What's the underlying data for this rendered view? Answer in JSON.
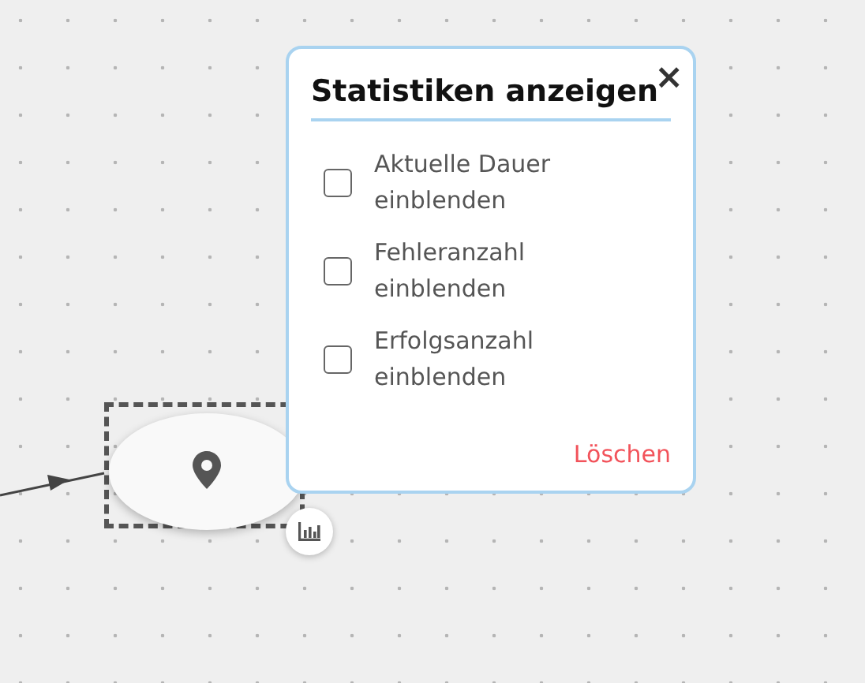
{
  "popup": {
    "title": "Statistiken anzeigen",
    "close": "×",
    "options": [
      {
        "label": "Aktuelle Dauer einblenden",
        "checked": false
      },
      {
        "label": "Fehleranzahl einblenden",
        "checked": false
      },
      {
        "label": "Erfolgsanzahl einblenden",
        "checked": false
      }
    ],
    "clear": "Löschen"
  }
}
